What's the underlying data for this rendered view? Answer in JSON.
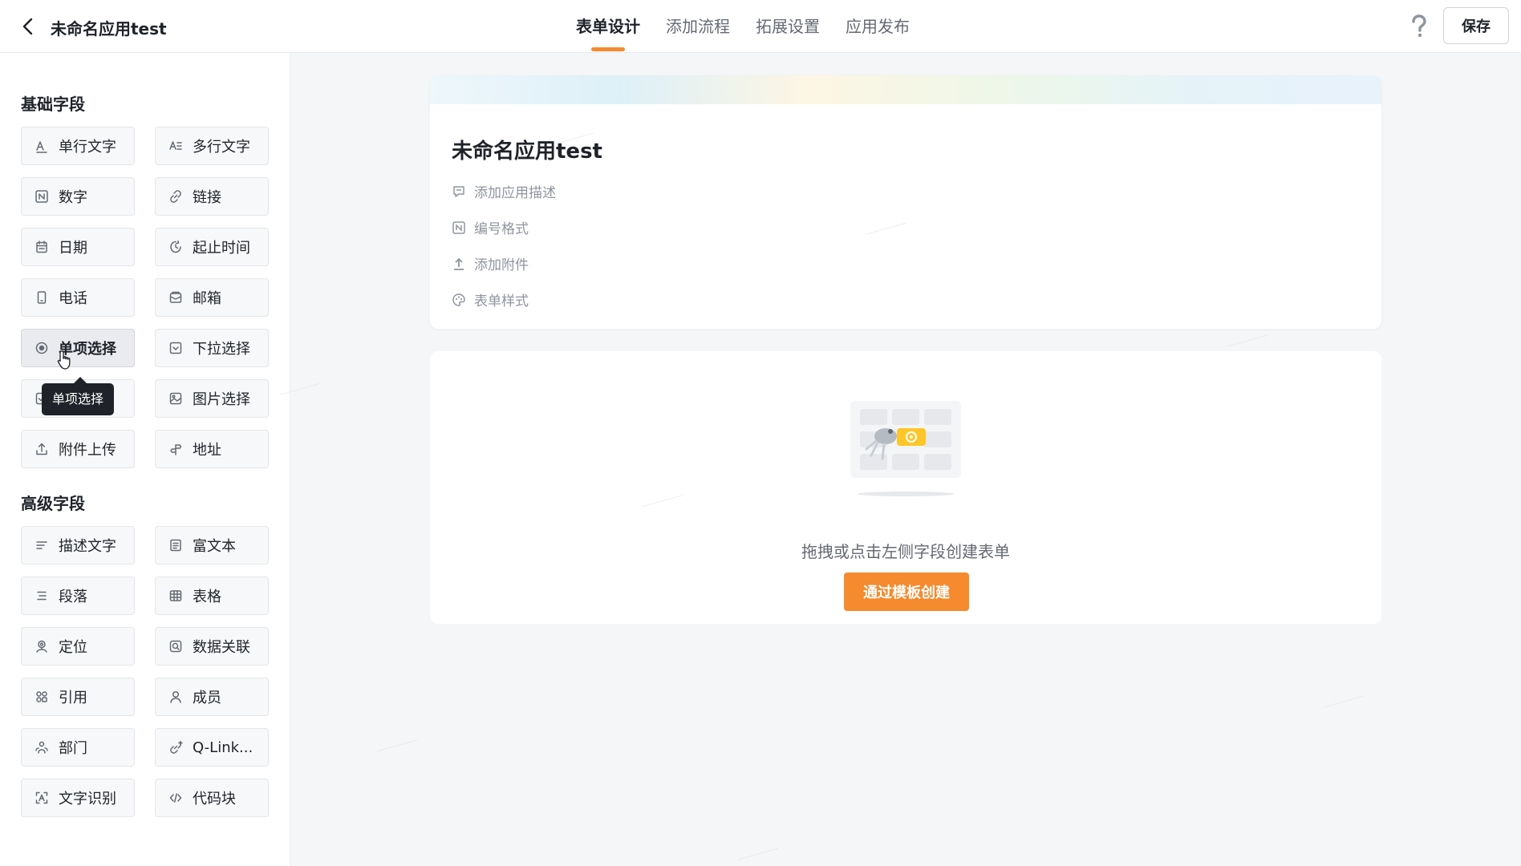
{
  "header": {
    "app_title": "未命名应用test",
    "tabs": [
      {
        "label": "表单设计",
        "active": true
      },
      {
        "label": "添加流程",
        "active": false
      },
      {
        "label": "拓展设置",
        "active": false
      },
      {
        "label": "应用发布",
        "active": false
      }
    ],
    "save_label": "保存"
  },
  "sidebar": {
    "basic_title": "基础字段",
    "basic_fields": [
      {
        "label": "单行文字",
        "icon": "single-line-text-icon"
      },
      {
        "label": "多行文字",
        "icon": "multi-line-text-icon"
      },
      {
        "label": "数字",
        "icon": "number-icon"
      },
      {
        "label": "链接",
        "icon": "link-icon"
      },
      {
        "label": "日期",
        "icon": "calendar-icon"
      },
      {
        "label": "起止时间",
        "icon": "time-range-icon"
      },
      {
        "label": "电话",
        "icon": "phone-icon"
      },
      {
        "label": "邮箱",
        "icon": "mail-icon"
      },
      {
        "label": "单项选择",
        "icon": "radio-icon"
      },
      {
        "label": "下拉选择",
        "icon": "dropdown-icon"
      },
      {
        "label": "",
        "icon": "checkbox-icon"
      },
      {
        "label": "图片选择",
        "icon": "image-icon"
      },
      {
        "label": "附件上传",
        "icon": "upload-icon"
      },
      {
        "label": "地址",
        "icon": "address-icon"
      }
    ],
    "advanced_title": "高级字段",
    "advanced_fields": [
      {
        "label": "描述文字",
        "icon": "description-icon"
      },
      {
        "label": "富文本",
        "icon": "rich-text-icon"
      },
      {
        "label": "段落",
        "icon": "paragraph-icon"
      },
      {
        "label": "表格",
        "icon": "table-icon"
      },
      {
        "label": "定位",
        "icon": "location-icon"
      },
      {
        "label": "数据关联",
        "icon": "data-link-icon"
      },
      {
        "label": "引用",
        "icon": "reference-icon"
      },
      {
        "label": "成员",
        "icon": "member-icon"
      },
      {
        "label": "部门",
        "icon": "department-icon"
      },
      {
        "label": "Q-Link...",
        "icon": "q-link-icon"
      },
      {
        "label": "文字识别",
        "icon": "text-recognition-icon"
      },
      {
        "label": "代码块",
        "icon": "code-block-icon"
      }
    ],
    "tooltip": "单项选择"
  },
  "form": {
    "title": "未命名应用test",
    "meta": [
      {
        "label": "添加应用描述",
        "icon": "comment-icon"
      },
      {
        "label": "编号格式",
        "icon": "serial-number-icon"
      },
      {
        "label": "添加附件",
        "icon": "attachment-upload-icon"
      },
      {
        "label": "表单样式",
        "icon": "palette-icon"
      }
    ]
  },
  "canvas": {
    "empty_text": "拖拽或点击左侧字段创建表单",
    "template_button": "通过模板创建"
  },
  "colors": {
    "accent": "#f58a2e",
    "text_primary": "#1f2329",
    "text_secondary": "#646a73",
    "text_muted": "#8f959e"
  }
}
